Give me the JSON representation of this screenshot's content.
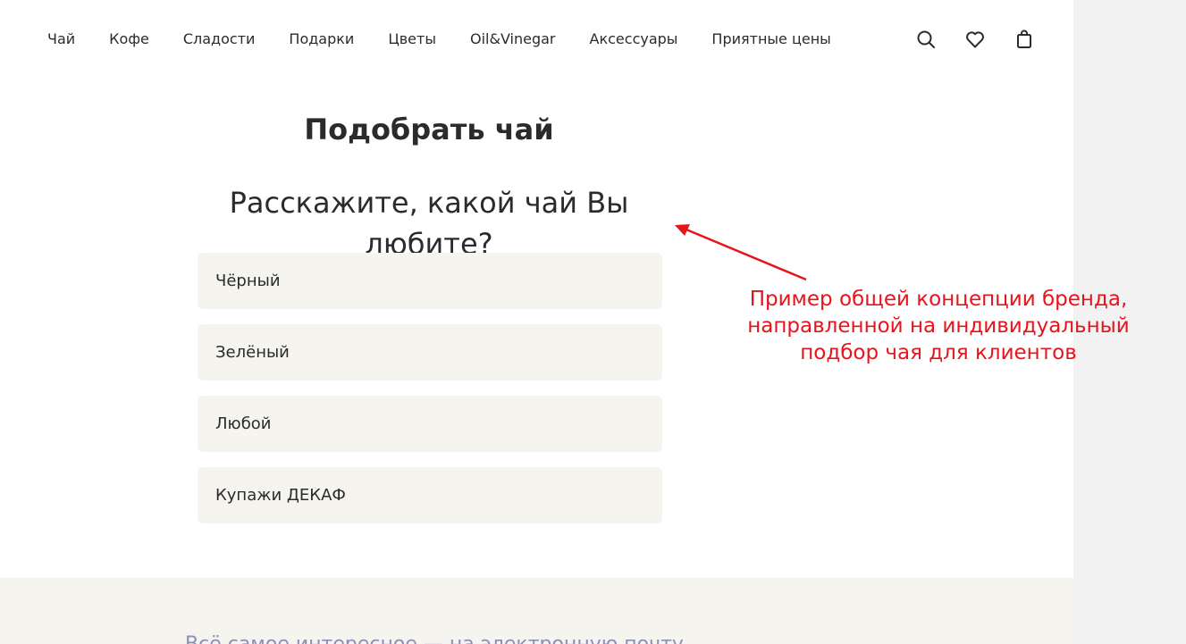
{
  "nav": {
    "items": [
      "Чай",
      "Кофе",
      "Сладости",
      "Подарки",
      "Цветы",
      "Oil&Vinegar",
      "Аксессуары",
      "Приятные цены"
    ],
    "icons": [
      "search-icon",
      "heart-icon",
      "bag-icon"
    ]
  },
  "main": {
    "title": "Подобрать чай",
    "question": "Расскажите, какой чай Вы любите?",
    "options": [
      "Чёрный",
      "Зелёный",
      "Любой",
      "Купажи ДЕКАФ"
    ]
  },
  "footer": {
    "text": "Всё самое интересное — на электронную почту"
  },
  "annotation": {
    "text_lines": [
      "Пример общей концепции бренда,",
      "направленной на индивидуальный",
      "подбор чая для клиентов"
    ],
    "color": "#e8141c"
  },
  "colors": {
    "option_bg": "#f5f4ef",
    "text": "#2b2b2b",
    "footer_text": "#8c90b8"
  }
}
